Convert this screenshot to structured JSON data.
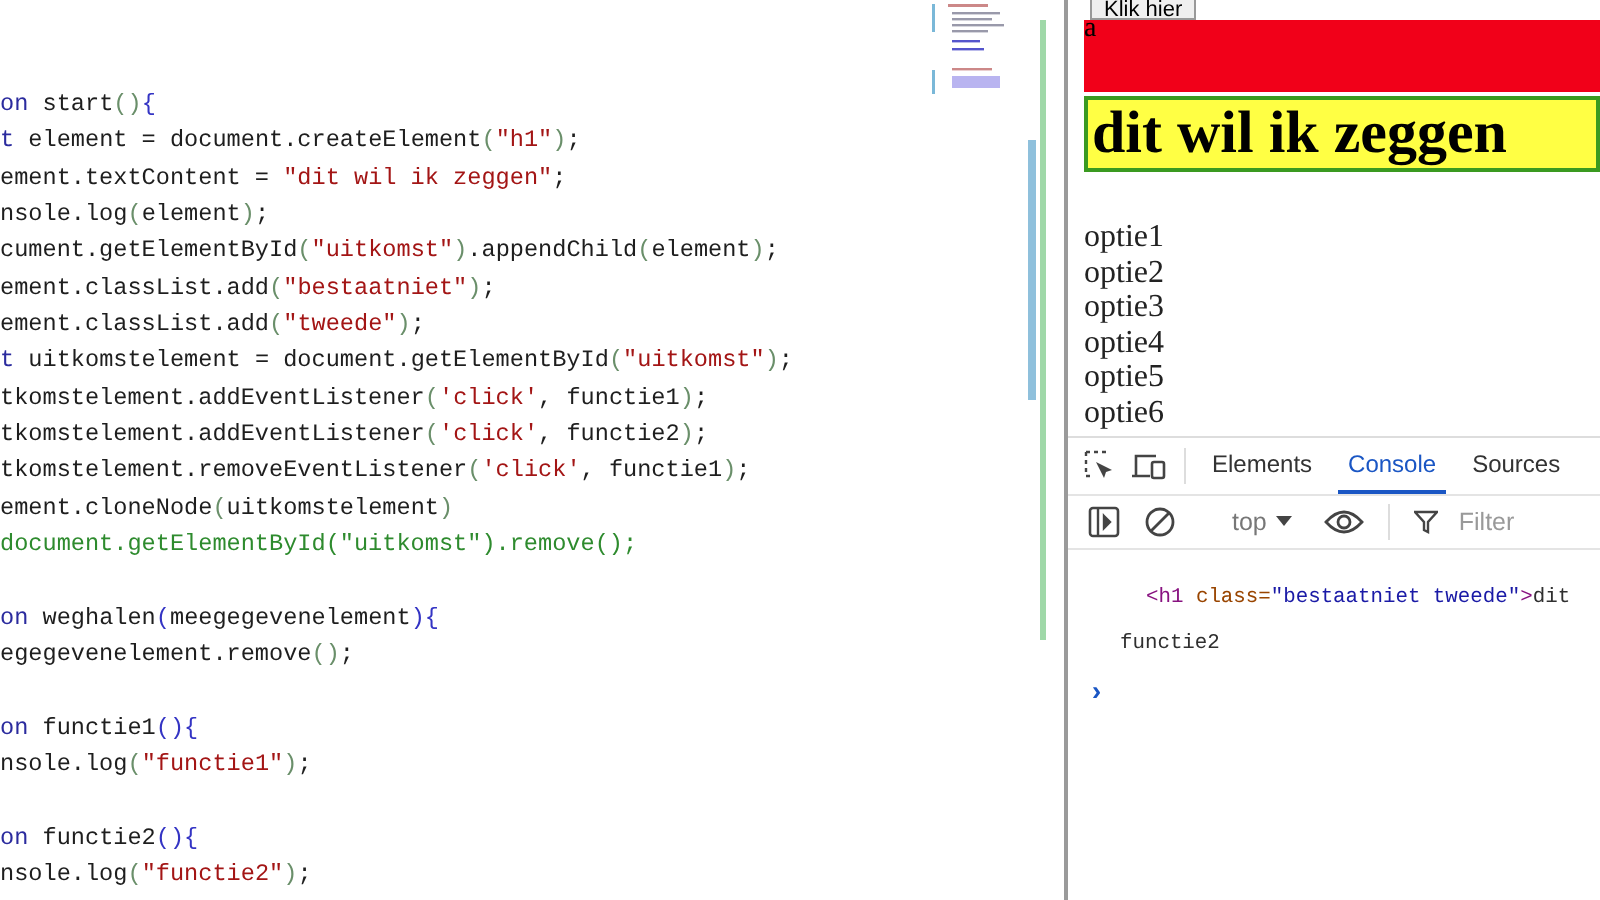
{
  "editor": {
    "blocks": [
      [
        [
          {
            "kind": "keyword",
            "text": "on"
          },
          {
            "kind": "plain",
            "text": " start"
          },
          {
            "kind": "bracket",
            "text": "()"
          },
          {
            "kind": "brace",
            "text": "{"
          }
        ],
        [
          {
            "kind": "keyword",
            "text": "t"
          },
          {
            "kind": "plain",
            "text": " element = document.createElement"
          },
          {
            "kind": "bracket",
            "text": "("
          },
          {
            "kind": "string",
            "text": "\"h1\""
          },
          {
            "kind": "bracket",
            "text": ")"
          },
          {
            "kind": "plain",
            "text": ";"
          }
        ],
        [
          {
            "kind": "plain",
            "text": "ement.textContent = "
          },
          {
            "kind": "string",
            "text": "\"dit wil ik zeggen\""
          },
          {
            "kind": "plain",
            "text": ";"
          }
        ],
        [
          {
            "kind": "plain",
            "text": "nsole.log"
          },
          {
            "kind": "bracket",
            "text": "("
          },
          {
            "kind": "plain",
            "text": "element"
          },
          {
            "kind": "bracket",
            "text": ")"
          },
          {
            "kind": "plain",
            "text": ";"
          }
        ],
        [
          {
            "kind": "plain",
            "text": "cument.getElementById"
          },
          {
            "kind": "bracket",
            "text": "("
          },
          {
            "kind": "string",
            "text": "\"uitkomst\""
          },
          {
            "kind": "bracket",
            "text": ")"
          },
          {
            "kind": "plain",
            "text": ".appendChild"
          },
          {
            "kind": "bracket",
            "text": "("
          },
          {
            "kind": "plain",
            "text": "element"
          },
          {
            "kind": "bracket",
            "text": ")"
          },
          {
            "kind": "plain",
            "text": ";"
          }
        ],
        [
          {
            "kind": "plain",
            "text": "ement.classList.add"
          },
          {
            "kind": "bracket",
            "text": "("
          },
          {
            "kind": "string",
            "text": "\"bestaatniet\""
          },
          {
            "kind": "bracket",
            "text": ")"
          },
          {
            "kind": "plain",
            "text": ";"
          }
        ],
        [
          {
            "kind": "plain",
            "text": "ement.classList.add"
          },
          {
            "kind": "bracket",
            "text": "("
          },
          {
            "kind": "string",
            "text": "\"tweede\""
          },
          {
            "kind": "bracket",
            "text": ")"
          },
          {
            "kind": "plain",
            "text": ";"
          }
        ],
        [
          {
            "kind": "keyword",
            "text": "t"
          },
          {
            "kind": "plain",
            "text": " uitkomstelement = document.getElementById"
          },
          {
            "kind": "bracket",
            "text": "("
          },
          {
            "kind": "string",
            "text": "\"uitkomst\""
          },
          {
            "kind": "bracket",
            "text": ")"
          },
          {
            "kind": "plain",
            "text": ";"
          }
        ],
        [
          {
            "kind": "plain",
            "text": "tkomstelement.addEventListener"
          },
          {
            "kind": "bracket",
            "text": "("
          },
          {
            "kind": "string",
            "text": "'click'"
          },
          {
            "kind": "plain",
            "text": ", functie1"
          },
          {
            "kind": "bracket",
            "text": ")"
          },
          {
            "kind": "plain",
            "text": ";"
          }
        ],
        [
          {
            "kind": "plain",
            "text": "tkomstelement.addEventListener"
          },
          {
            "kind": "bracket",
            "text": "("
          },
          {
            "kind": "string",
            "text": "'click'"
          },
          {
            "kind": "plain",
            "text": ", functie2"
          },
          {
            "kind": "bracket",
            "text": ")"
          },
          {
            "kind": "plain",
            "text": ";"
          }
        ],
        [
          {
            "kind": "plain",
            "text": "tkomstelement.removeEventListener"
          },
          {
            "kind": "bracket",
            "text": "("
          },
          {
            "kind": "string",
            "text": "'click'"
          },
          {
            "kind": "plain",
            "text": ", functie1"
          },
          {
            "kind": "bracket",
            "text": ")"
          },
          {
            "kind": "plain",
            "text": ";"
          }
        ],
        [
          {
            "kind": "plain",
            "text": "ement.cloneNode"
          },
          {
            "kind": "bracket",
            "text": "("
          },
          {
            "kind": "plain",
            "text": "uitkomstelement"
          },
          {
            "kind": "bracket",
            "text": ")"
          }
        ],
        [
          {
            "kind": "comment",
            "text": "document.getElementById(\"uitkomst\").remove();"
          }
        ]
      ],
      [
        [
          {
            "kind": "keyword",
            "text": "on"
          },
          {
            "kind": "plain",
            "text": " weghalen"
          },
          {
            "kind": "brace",
            "text": "("
          },
          {
            "kind": "plain",
            "text": "meegegevenelement"
          },
          {
            "kind": "brace",
            "text": "){"
          }
        ],
        [
          {
            "kind": "plain",
            "text": "egegevenelement.remove"
          },
          {
            "kind": "bracket",
            "text": "()"
          },
          {
            "kind": "plain",
            "text": ";"
          }
        ]
      ],
      [
        [
          {
            "kind": "keyword",
            "text": "on"
          },
          {
            "kind": "plain",
            "text": " functie1"
          },
          {
            "kind": "brace",
            "text": "(){"
          }
        ],
        [
          {
            "kind": "plain",
            "text": "nsole.log"
          },
          {
            "kind": "bracket",
            "text": "("
          },
          {
            "kind": "string",
            "text": "\"functie1\""
          },
          {
            "kind": "bracket",
            "text": ")"
          },
          {
            "kind": "plain",
            "text": ";"
          }
        ]
      ],
      [
        [
          {
            "kind": "keyword",
            "text": "on"
          },
          {
            "kind": "plain",
            "text": " functie2"
          },
          {
            "kind": "brace",
            "text": "(){"
          }
        ],
        [
          {
            "kind": "plain",
            "text": "nsole.log"
          },
          {
            "kind": "bracket",
            "text": "("
          },
          {
            "kind": "string",
            "text": "\"functie2\""
          },
          {
            "kind": "bracket",
            "text": ")"
          },
          {
            "kind": "plain",
            "text": ";"
          }
        ]
      ]
    ]
  },
  "page": {
    "button": "Klik hier",
    "red_block": "a",
    "heading": "dit wil ik zeggen",
    "options": [
      "optie1",
      "optie2",
      "optie3",
      "optie4",
      "optie5",
      "optie6"
    ]
  },
  "devtools": {
    "tabs": [
      {
        "label": "Elements",
        "selected": false
      },
      {
        "label": "Console",
        "selected": true
      },
      {
        "label": "Sources",
        "selected": false
      }
    ],
    "context": "top",
    "filter": {
      "placeholder": "Filter"
    },
    "messages": [
      [
        {
          "kind": "tag",
          "text": "<h1"
        },
        {
          "kind": "attr",
          "text": " class="
        },
        {
          "kind": "value",
          "text": "\"bestaatniet tweede\""
        },
        {
          "kind": "tag",
          "text": ">"
        },
        {
          "kind": "plain",
          "text": "dit"
        }
      ],
      [
        {
          "kind": "plain",
          "text": "functie2"
        }
      ]
    ],
    "prompt": "›"
  }
}
